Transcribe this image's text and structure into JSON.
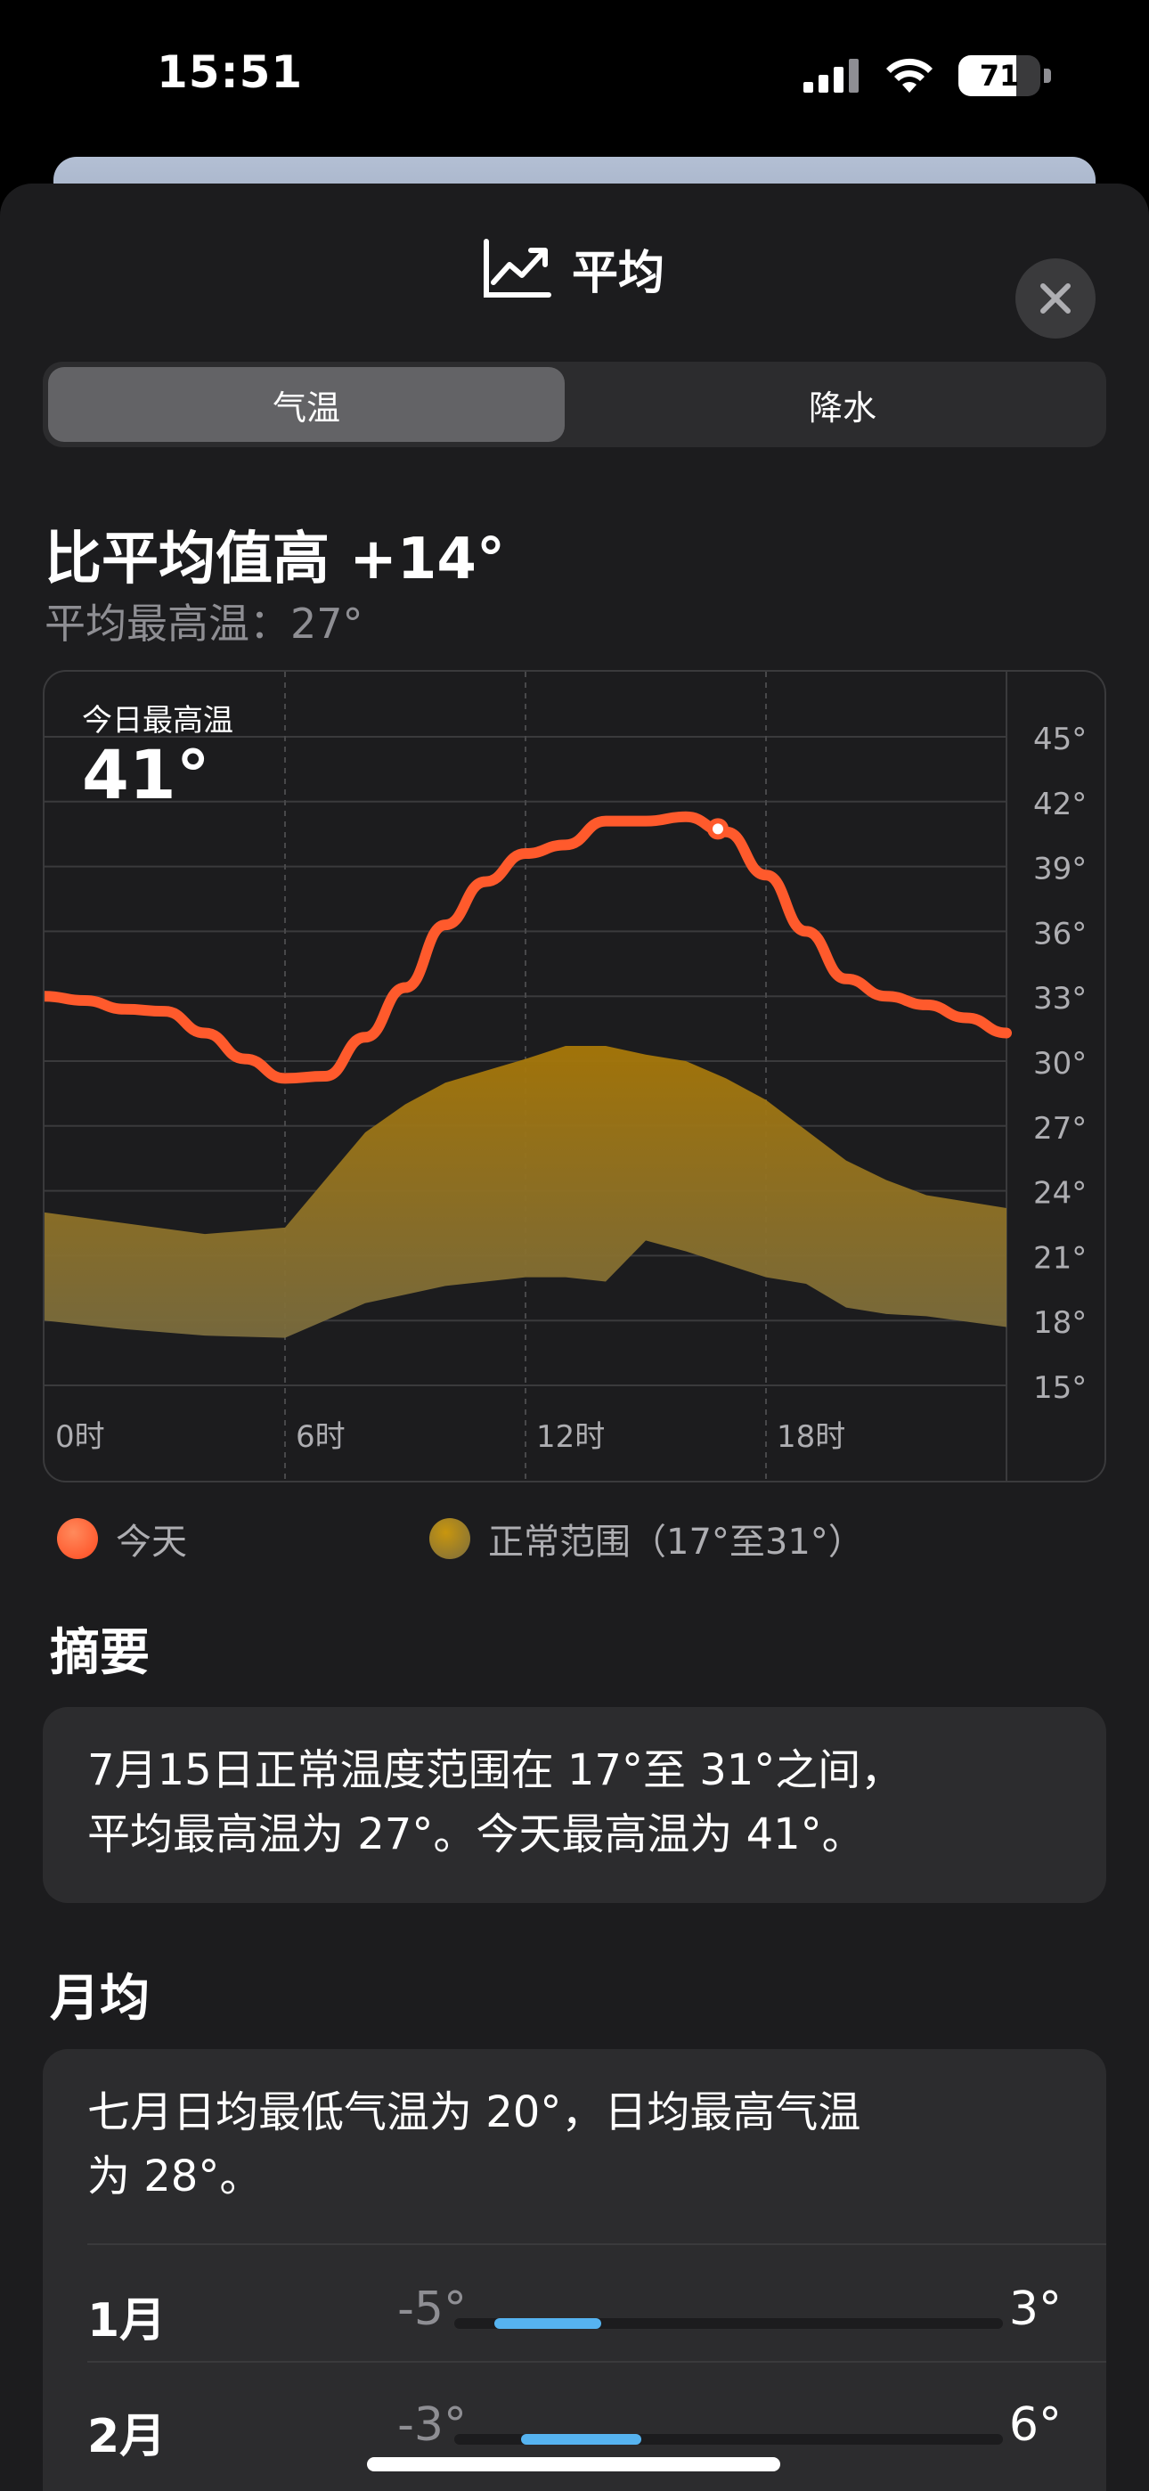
{
  "status": {
    "time": "15:51",
    "battery": "71"
  },
  "header": {
    "title": "平均",
    "icon": "chart-line-up-icon",
    "close_icon": "close-icon"
  },
  "segments": [
    "气温",
    "降水"
  ],
  "summary_headline": "比平均值高 +14°",
  "average_high_label": "平均最高温：27°",
  "chart": {
    "today_label": "今日最高温",
    "today_value": "41°"
  },
  "chart_data": {
    "type": "line",
    "x_ticks": [
      "0时",
      "6时",
      "12时",
      "18时"
    ],
    "y_ticks": [
      "45°",
      "42°",
      "39°",
      "36°",
      "33°",
      "30°",
      "27°",
      "24°",
      "21°",
      "18°",
      "15°"
    ],
    "ylim": [
      15,
      45
    ],
    "xlim": [
      0,
      24
    ],
    "series": [
      {
        "name": "今天",
        "color": "#ff5a2c",
        "x": [
          0,
          1,
          2,
          3,
          4,
          5,
          6,
          7,
          8,
          9,
          10,
          11,
          12,
          13,
          14,
          15,
          16,
          17,
          18,
          19,
          20,
          21,
          22,
          23,
          24
        ],
        "values": [
          33.0,
          32.8,
          32.4,
          32.3,
          31.3,
          30.1,
          29.2,
          29.3,
          31.1,
          33.4,
          36.3,
          38.3,
          39.6,
          40.0,
          41.1,
          41.1,
          41.3,
          40.6,
          38.6,
          36.0,
          33.8,
          33.0,
          32.6,
          32.0,
          31.3
        ],
        "marker_at": 16.8
      }
    ],
    "band": {
      "name": "正常范围",
      "label": "正常范围（17°至31°）",
      "color": "#b8860b",
      "x": [
        0,
        2,
        4,
        6,
        8,
        9,
        10,
        12,
        13,
        14,
        15,
        16,
        17,
        18,
        19,
        20,
        21,
        22,
        24
      ],
      "low": [
        18.0,
        17.6,
        17.3,
        17.2,
        18.8,
        19.2,
        19.6,
        20.0,
        20.0,
        19.8,
        21.7,
        21.2,
        20.6,
        20.0,
        19.7,
        18.6,
        18.3,
        18.2,
        17.7
      ],
      "high": [
        23.0,
        22.5,
        22.0,
        22.3,
        26.7,
        28.0,
        29.0,
        30.1,
        30.7,
        30.7,
        30.3,
        30.0,
        29.2,
        28.2,
        26.8,
        25.4,
        24.5,
        23.8,
        23.2
      ]
    }
  },
  "legend": {
    "today": "今天",
    "normal": "正常范围（17°至31°）",
    "today_color": "#ff5a2c",
    "normal_color": "#b8860b"
  },
  "summary": {
    "title": "摘要",
    "line1": "7月15日正常温度范围在 17°至 31°之间，",
    "line2": "平均最高温为 27°。今天最高温为 41°。"
  },
  "monthly": {
    "title": "月均",
    "line1": "七月日均最低气温为 20°，日均最高气温",
    "line2": "为 28°。",
    "months": [
      {
        "name": "1月",
        "low": "-5°",
        "high": "3°",
        "low_value": -5,
        "high_value": 3
      },
      {
        "name": "2月",
        "low": "-3°",
        "high": "6°",
        "low_value": -3,
        "high_value": 6
      }
    ],
    "scale_min": -8,
    "scale_max": 33
  }
}
